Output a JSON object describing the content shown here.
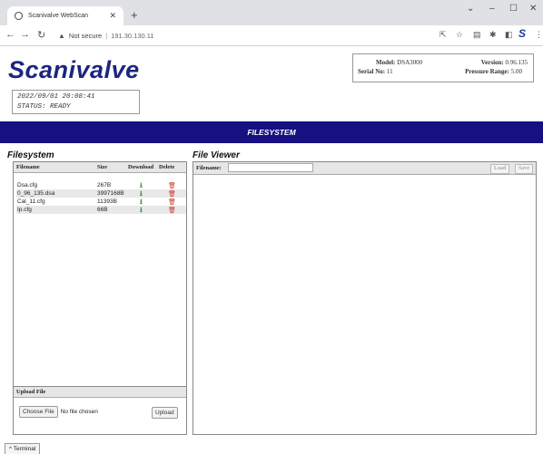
{
  "browser": {
    "tab_title": "Scanivalve WebScan",
    "new_tab": "+",
    "security": "Not secure",
    "url": "191.30.130.11",
    "window_controls": {
      "minimize": "–",
      "restore": "☐",
      "close": "✕",
      "collapse": "⌄"
    }
  },
  "header": {
    "logo": "Scanivalve",
    "datetime": "2022/09/01 20:08:41",
    "status": "STATUS: READY",
    "model_label": "Model:",
    "model": "DSA3000",
    "version_label": "Version:",
    "version": "0.96.135",
    "serial_label": "Serial No:",
    "serial": "11",
    "range_label": "Pressure Range:",
    "range": "5.00"
  },
  "banner": {
    "title": "FILESYSTEM"
  },
  "filesystem": {
    "title": "Filesystem",
    "columns": {
      "filename": "Filename",
      "size": "Size",
      "download": "Download",
      "delete": "Delete"
    },
    "files": [
      {
        "name": "Dsa.cfg",
        "size": "267B"
      },
      {
        "name": "0_96_135.dsa",
        "size": "3997168B"
      },
      {
        "name": "Cal_11.cfg",
        "size": "11393B"
      },
      {
        "name": "Ip.cfg",
        "size": "66B"
      }
    ],
    "upload_title": "Upload File",
    "choose_label": "Choose File",
    "no_file": "No file chosen",
    "upload_label": "Upload"
  },
  "viewer": {
    "title": "File Viewer",
    "filename_label": "Filename:",
    "load_label": "Load",
    "save_label": "Save"
  },
  "terminal": {
    "label": "^ Terminal"
  }
}
